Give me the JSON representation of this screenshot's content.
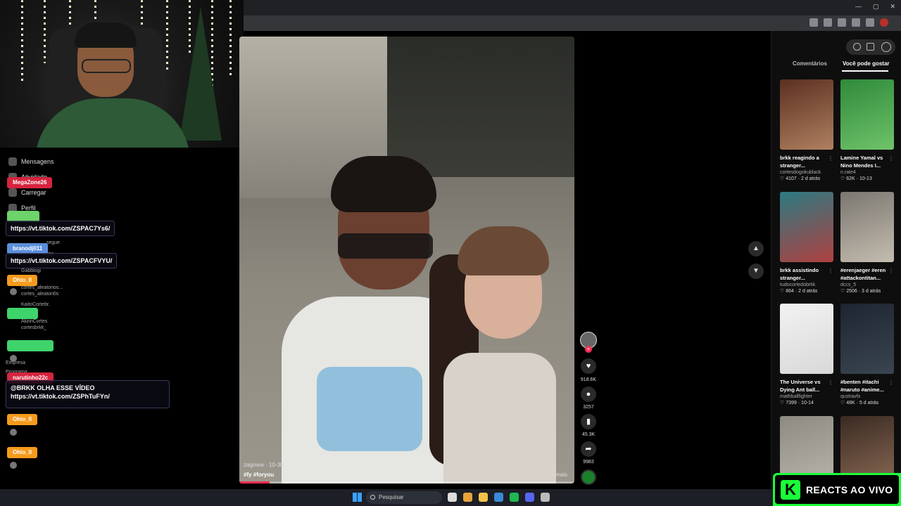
{
  "browser": {
    "window_controls": [
      "—",
      "▢",
      "✕"
    ],
    "toolbar_icons": [
      "translate-icon",
      "cast-icon",
      "star-icon",
      "extensions-icon",
      "sidebar-icon",
      "profile-icon"
    ]
  },
  "chat": {
    "menu": [
      {
        "label": "Mensagens",
        "icon": "inbox-icon"
      },
      {
        "label": "Atividade",
        "icon": "activity-icon"
      },
      {
        "label": "Carregar",
        "icon": "upload-icon"
      },
      {
        "label": "Perfil",
        "icon": "profile-icon"
      }
    ],
    "faint_labels": [
      "segue",
      "clips",
      "Gabblogi",
      "cortes_aleatorios...",
      "cortes_aleatori0s",
      "KaitoCortebr.",
      "AlizinCortes",
      "cortesbrkk_",
      "Empresa",
      "Programa"
    ],
    "messages": [
      {
        "user": "MegaZone26",
        "user_color": "#d6243f",
        "text": ""
      },
      {
        "user": "",
        "user_color": "#6ed36a",
        "text": "https://vt.tiktok.com/ZSPAC7Ys6/"
      },
      {
        "user": "branodj011",
        "user_color": "#5b8fdc",
        "text": "https://vt.tiktok.com/ZSPACFVYU/"
      },
      {
        "user": "Ohio_ll",
        "user_color": "#f59b1c",
        "text": ""
      },
      {
        "user": "",
        "user_color": "#3fd36b",
        "text": ""
      },
      {
        "user": "",
        "user_color": "#3fd36b",
        "text": ""
      },
      {
        "user": "narutinho22c",
        "user_color": "#d6243f",
        "text": "@BRKK OLHA ESSE VÍDEO\nhttps://vt.tiktok.com/ZSPhTuFYn/"
      },
      {
        "user": "Ohio_ll",
        "user_color": "#f59b1c",
        "text": ""
      },
      {
        "user": "Ohio_ll",
        "user_color": "#f59b1c",
        "text": ""
      }
    ]
  },
  "video": {
    "author": "zagoww",
    "date": "10-30",
    "hashtags": "#fy #foryou",
    "more_label": "mais",
    "progress": 0.09
  },
  "actions": {
    "likes": "918.6K",
    "comments": "3257",
    "saves": "45.3K",
    "shares": "9983"
  },
  "panel": {
    "tabs": [
      "Comentários",
      "Você pode gostar"
    ],
    "active_tab": "Você pode gostar",
    "cards": [
      {
        "title": "brkk reagindo a stranger...",
        "author": "cortesdogokublack",
        "likes": "4107",
        "age": "2 d atrás",
        "thumb": [
          "#5a3020",
          "#b08060"
        ]
      },
      {
        "title": "Lamine Yamal vs Nino Mendes I...",
        "author": "n.rate4",
        "likes": "62K",
        "age": "10-13",
        "thumb": [
          "#2f8a3a",
          "#6fc36a"
        ]
      },
      {
        "title": "brkk assistindo stranger...",
        "author": "tudocortedobrkk",
        "likes": "864",
        "age": "2 d atrás",
        "thumb": [
          "#2c7a82",
          "#b04040"
        ]
      },
      {
        "title": "#erenjaeger #eren #attackontitan...",
        "author": "dccs_5",
        "likes": "2506",
        "age": "3 d atrás",
        "thumb": [
          "#7a7670",
          "#c4bdb0"
        ]
      },
      {
        "title": "The Universe vs Dying Ant ball...",
        "author": "mathballfighter",
        "likes": "7399",
        "age": "10-14",
        "thumb": [
          "#f2f2f2",
          "#d8d8d8"
        ]
      },
      {
        "title": "#benten #itachi #naruto #anime...",
        "author": "qustravfx",
        "likes": "48K",
        "age": "5 d atrás",
        "thumb": [
          "#1e2530",
          "#3a4550"
        ]
      },
      {
        "title": "",
        "author": "",
        "likes": "",
        "age": "",
        "thumb": [
          "#8d8a82",
          "#b8b5ad"
        ]
      },
      {
        "title": "",
        "author": "",
        "likes": "",
        "age": "",
        "thumb": [
          "#3a2a22",
          "#8a6a55"
        ]
      }
    ]
  },
  "taskbar": {
    "search_placeholder": "Pesquisar",
    "apps": [
      {
        "name": "task-view-icon",
        "color": "#dddddd"
      },
      {
        "name": "chrome-icon",
        "color": "#e8a33a"
      },
      {
        "name": "file-explorer-icon",
        "color": "#f2c24a"
      },
      {
        "name": "steam-icon",
        "color": "#3a8ad8"
      },
      {
        "name": "spotify-icon",
        "color": "#1db954"
      },
      {
        "name": "discord-icon",
        "color": "#5865f2"
      },
      {
        "name": "obs-icon",
        "color": "#bbbbbb"
      }
    ]
  },
  "watermark": {
    "logo": "K",
    "text": "REACTS AO VIVO"
  }
}
